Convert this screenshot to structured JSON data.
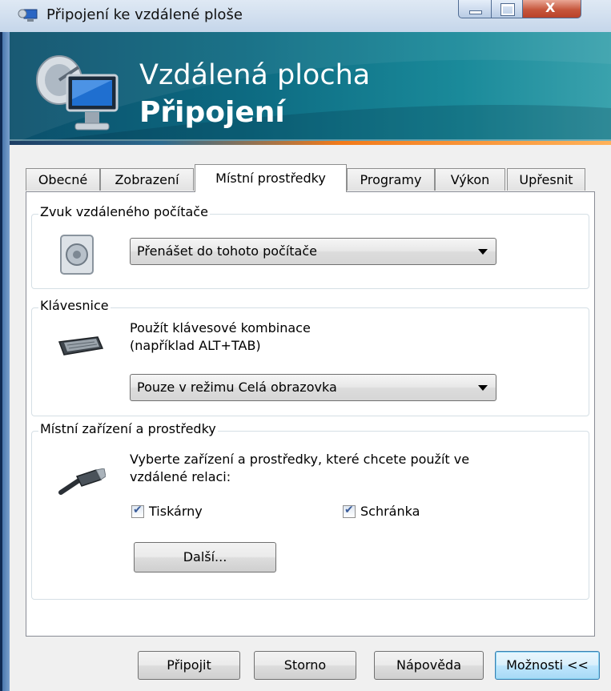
{
  "window": {
    "title": "Připojení ke vzdálené ploše",
    "close_glyph": "X"
  },
  "banner": {
    "line1": "Vzdálená plocha",
    "line2": "Připojení"
  },
  "tabs": [
    {
      "label": "Obecné"
    },
    {
      "label": "Zobrazení"
    },
    {
      "label": "Místní prostředky"
    },
    {
      "label": "Programy"
    },
    {
      "label": "Výkon"
    },
    {
      "label": "Upřesnit"
    }
  ],
  "sound": {
    "group_label": "Zvuk vzdáleného počítače",
    "selected": "Přenášet do tohoto počítače"
  },
  "keyboard": {
    "group_label": "Klávesnice",
    "description_line1": "Použít klávesové kombinace",
    "description_line2": "(například ALT+TAB)",
    "selected": "Pouze v režimu Celá obrazovka"
  },
  "devices": {
    "group_label": "Místní zařízení a prostředky",
    "description_line1": "Vyberte zařízení a prostředky, které chcete použít ve",
    "description_line2": "vzdálené relaci:",
    "printers_label": "Tiskárny",
    "printers_checked": true,
    "clipboard_label": "Schránka",
    "clipboard_checked": true,
    "more_button": "Další..."
  },
  "footer": {
    "connect": "Připojit",
    "cancel": "Storno",
    "help": "Nápověda",
    "options": "Možnosti <<"
  },
  "colors": {
    "banner_start": "#0b4f6b",
    "banner_end": "#3aa2ad",
    "accent_orange": "#f27a1a",
    "checkmark": "#3b5d9a"
  },
  "icons": {
    "title": "remote-desktop-icon",
    "banner": "remote-desktop-monitor-icon",
    "sound": "speaker-icon",
    "keyboard": "keyboard-icon",
    "devices": "usb-plug-icon"
  }
}
